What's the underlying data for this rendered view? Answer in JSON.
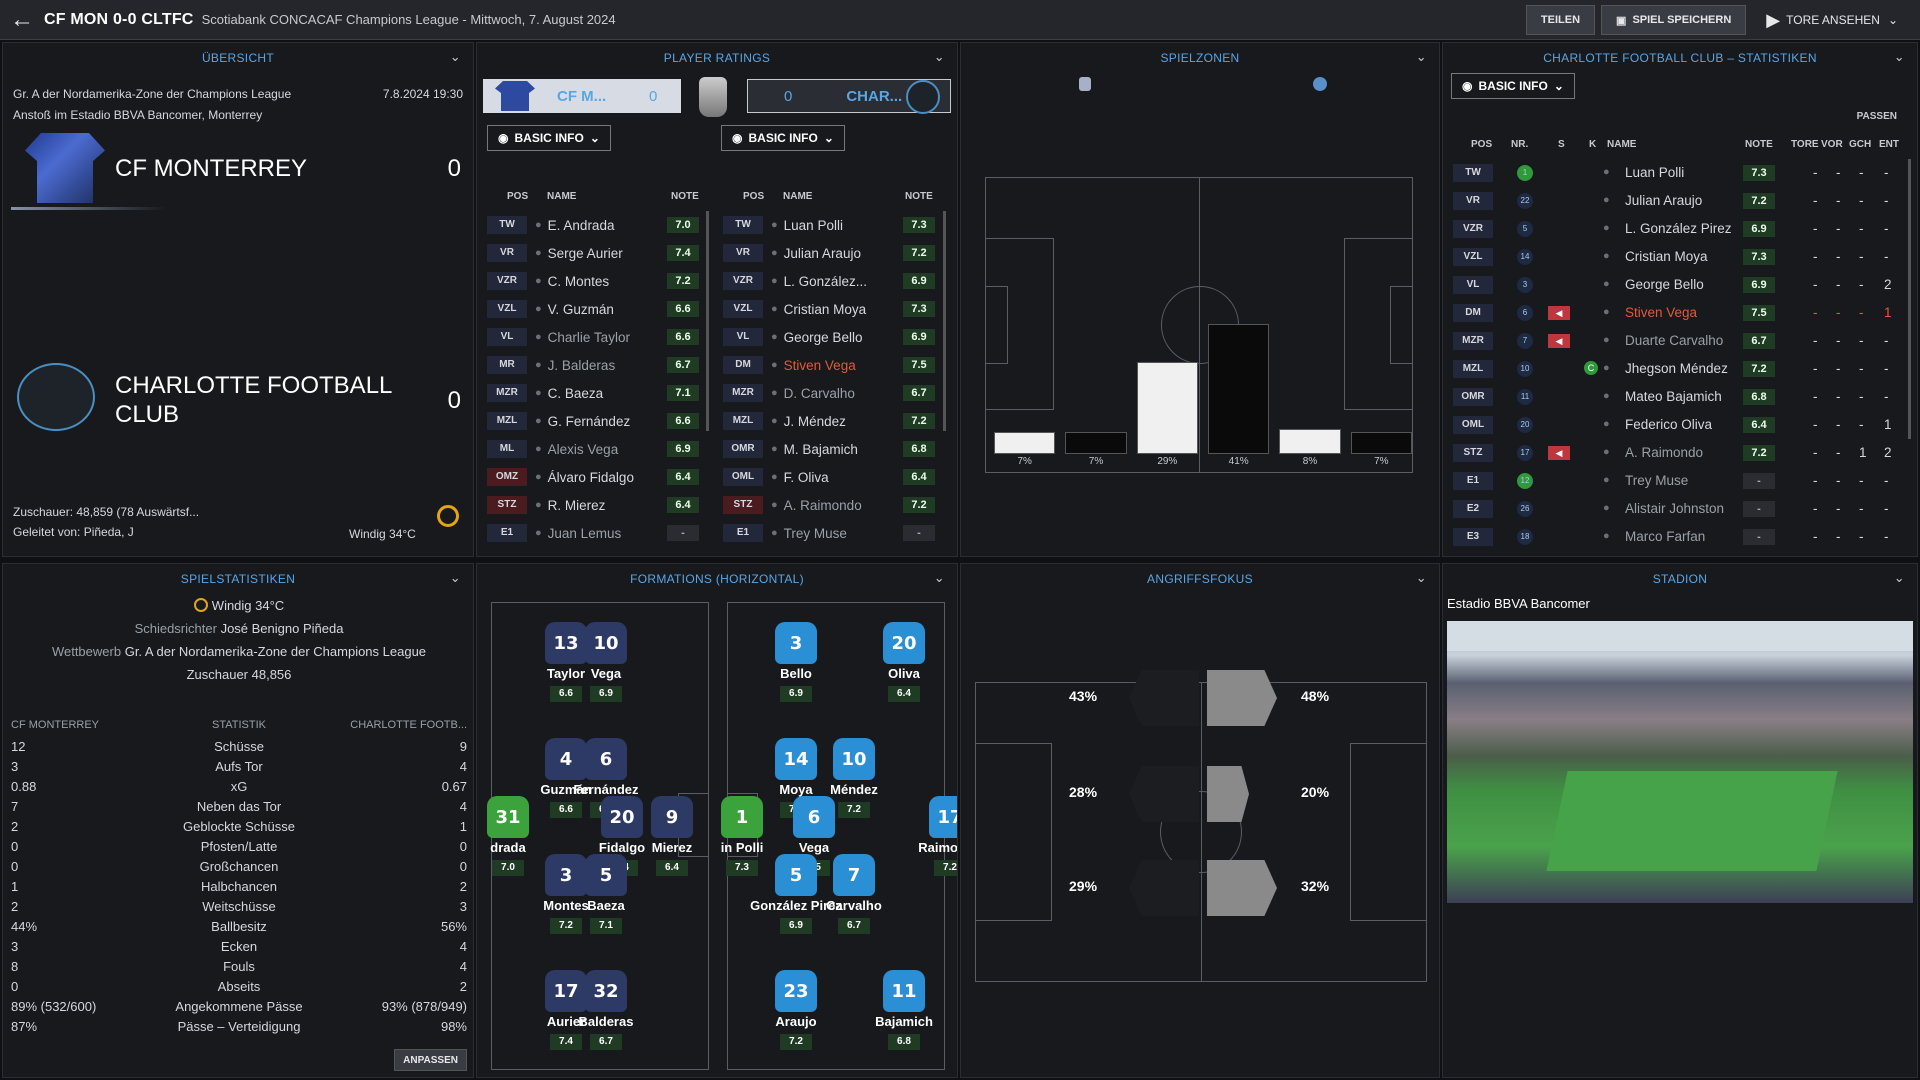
{
  "header": {
    "title_teams": "CF MON 0-0 CLTFC",
    "subtitle": "Scotiabank CONCACAF Champions League - Mittwoch, 7. August 2024",
    "buttons": [
      "TEILEN",
      "SPIEL SPEICHERN",
      "TORE ANSEHEN"
    ]
  },
  "overview": {
    "title": "ÜBERSICHT",
    "competition": "Gr. A der Nordamerika-Zone der Champions League",
    "datetime": "7.8.2024 19:30",
    "venue": "Anstoß im Estadio BBVA Bancomer, Monterrey",
    "home_name": "CF MONTERREY",
    "home_score": "0",
    "away_name": "CHARLOTTE FOOTBALL CLUB",
    "away_score": "0",
    "attendance": "Zuschauer: 48,859 (78 Auswärtsf...",
    "referee": "Geleitet von: Piñeda, J",
    "weather": "Windig 34°C"
  },
  "ratings": {
    "title": "PLAYER RATINGS",
    "home_short": "CF M...",
    "home_score": "0",
    "away_short": "CHAR...",
    "away_score": "0",
    "dropdown": "BASIC INFO",
    "col_pos": "POS",
    "col_name": "NAME",
    "col_note": "NOTE",
    "home": [
      {
        "pos": "TW",
        "name": "E. Andrada",
        "note": "7.0"
      },
      {
        "pos": "VR",
        "name": "Serge Aurier",
        "note": "7.4"
      },
      {
        "pos": "VZR",
        "name": "C. Montes",
        "note": "7.2"
      },
      {
        "pos": "VZL",
        "name": "V. Guzmán",
        "note": "6.6"
      },
      {
        "pos": "VL",
        "name": "Charlie Taylor",
        "note": "6.6"
      },
      {
        "pos": "MR",
        "name": "J. Balderas",
        "note": "6.7"
      },
      {
        "pos": "MZR",
        "name": "C. Baeza",
        "note": "7.1"
      },
      {
        "pos": "MZL",
        "name": "G. Fernández",
        "note": "6.6"
      },
      {
        "pos": "ML",
        "name": "Alexis Vega",
        "note": "6.9"
      },
      {
        "pos": "OMZ",
        "name": "Álvaro Fidalgo",
        "note": "6.4"
      },
      {
        "pos": "STZ",
        "name": "R. Mierez",
        "note": "6.4"
      },
      {
        "pos": "E1",
        "name": "Juan Lemus",
        "note": "-"
      }
    ],
    "away": [
      {
        "pos": "TW",
        "name": "Luan Polli",
        "note": "7.3"
      },
      {
        "pos": "VR",
        "name": "Julian Araujo",
        "note": "7.2"
      },
      {
        "pos": "VZR",
        "name": "L. González...",
        "note": "6.9"
      },
      {
        "pos": "VZL",
        "name": "Cristian Moya",
        "note": "7.3"
      },
      {
        "pos": "VL",
        "name": "George Bello",
        "note": "6.9"
      },
      {
        "pos": "DM",
        "name": "Stiven Vega",
        "note": "7.5"
      },
      {
        "pos": "MZR",
        "name": "D. Carvalho",
        "note": "6.7"
      },
      {
        "pos": "MZL",
        "name": "J. Méndez",
        "note": "7.2"
      },
      {
        "pos": "OMR",
        "name": "M. Bajamich",
        "note": "6.8"
      },
      {
        "pos": "OML",
        "name": "F. Oliva",
        "note": "6.4"
      },
      {
        "pos": "STZ",
        "name": "A. Raimondo",
        "note": "7.2"
      },
      {
        "pos": "E1",
        "name": "Trey Muse",
        "note": "-"
      }
    ]
  },
  "zones": {
    "title": "SPIELZONEN",
    "labels": [
      "7%",
      "7%",
      "29%",
      "41%",
      "8%",
      "7%"
    ],
    "values": [
      7,
      7,
      29,
      41,
      8,
      7
    ]
  },
  "stats_table": {
    "title": "CHARLOTTE FOOTBALL CLUB – STATISTIKEN",
    "dropdown": "BASIC INFO",
    "group": "PASSEN",
    "cols": [
      "POS",
      "NR.",
      "S",
      "K",
      "NAME",
      "NOTE",
      "TORE",
      "VOR",
      "GCH",
      "ENT"
    ],
    "rows": [
      {
        "pos": "TW",
        "nr": "1",
        "name": "Luan Polli",
        "note": "7.3",
        "tore": "-",
        "vor": "-",
        "gch": "-",
        "ent": "-"
      },
      {
        "pos": "VR",
        "nr": "22",
        "name": "Julian Araujo",
        "note": "7.2",
        "tore": "-",
        "vor": "-",
        "gch": "-",
        "ent": "-"
      },
      {
        "pos": "VZR",
        "nr": "5",
        "name": "L. González Pirez",
        "note": "6.9",
        "tore": "-",
        "vor": "-",
        "gch": "-",
        "ent": "-"
      },
      {
        "pos": "VZL",
        "nr": "14",
        "name": "Cristian Moya",
        "note": "7.3",
        "tore": "-",
        "vor": "-",
        "gch": "-",
        "ent": "-"
      },
      {
        "pos": "VL",
        "nr": "3",
        "name": "George Bello",
        "note": "6.9",
        "tore": "-",
        "vor": "-",
        "gch": "-",
        "ent": "2"
      },
      {
        "pos": "DM",
        "nr": "6",
        "name": "Stiven Vega",
        "note": "7.5",
        "tore": "-",
        "vor": "-",
        "gch": "-",
        "ent": "1"
      },
      {
        "pos": "MZR",
        "nr": "7",
        "name": "Duarte Carvalho",
        "note": "6.7",
        "tore": "-",
        "vor": "-",
        "gch": "-",
        "ent": "-"
      },
      {
        "pos": "MZL",
        "nr": "10",
        "name": "Jhegson Méndez",
        "note": "7.2",
        "tore": "-",
        "vor": "-",
        "gch": "-",
        "ent": "-"
      },
      {
        "pos": "OMR",
        "nr": "11",
        "name": "Mateo Bajamich",
        "note": "6.8",
        "tore": "-",
        "vor": "-",
        "gch": "-",
        "ent": "-"
      },
      {
        "pos": "OML",
        "nr": "20",
        "name": "Federico Oliva",
        "note": "6.4",
        "tore": "-",
        "vor": "-",
        "gch": "-",
        "ent": "1"
      },
      {
        "pos": "STZ",
        "nr": "17",
        "name": "A. Raimondo",
        "note": "7.2",
        "tore": "-",
        "vor": "-",
        "gch": "1",
        "ent": "2"
      },
      {
        "pos": "E1",
        "nr": "12",
        "name": "Trey Muse",
        "note": "-",
        "tore": "-",
        "vor": "-",
        "gch": "-",
        "ent": "-"
      },
      {
        "pos": "E2",
        "nr": "26",
        "name": "Alistair Johnston",
        "note": "-",
        "tore": "-",
        "vor": "-",
        "gch": "-",
        "ent": "-"
      },
      {
        "pos": "E3",
        "nr": "18",
        "name": "Marco Farfan",
        "note": "-",
        "tore": "-",
        "vor": "-",
        "gch": "-",
        "ent": "-"
      }
    ]
  },
  "match_stats": {
    "title": "SPIELSTATISTIKEN",
    "weather": "Windig 34°C",
    "ref_label": "Schiedsrichter",
    "ref_name": "José Benigno Piñeda",
    "comp_label": "Wettbewerb",
    "comp_name": "Gr. A der Nordamerika-Zone der Champions League",
    "attendance": "Zuschauer 48,856",
    "col_home": "CF MONTERREY",
    "col_stat": "STATISTIK",
    "col_away": "CHARLOTTE FOOTB...",
    "rows": [
      {
        "h": "12",
        "s": "Schüsse",
        "a": "9"
      },
      {
        "h": "3",
        "s": "Aufs Tor",
        "a": "4"
      },
      {
        "h": "0.88",
        "s": "xG",
        "a": "0.67"
      },
      {
        "h": "7",
        "s": "Neben das Tor",
        "a": "4"
      },
      {
        "h": "2",
        "s": "Geblockte Schüsse",
        "a": "1"
      },
      {
        "h": "0",
        "s": "Pfosten/Latte",
        "a": "0"
      },
      {
        "h": "0",
        "s": "Großchancen",
        "a": "0"
      },
      {
        "h": "1",
        "s": "Halbchancen",
        "a": "2"
      },
      {
        "h": "2",
        "s": "Weitschüsse",
        "a": "3"
      },
      {
        "h": "44%",
        "s": "Ballbesitz",
        "a": "56%"
      },
      {
        "h": "3",
        "s": "Ecken",
        "a": "4"
      },
      {
        "h": "8",
        "s": "Fouls",
        "a": "4"
      },
      {
        "h": "0",
        "s": "Abseits",
        "a": "2"
      },
      {
        "h": "89% (532/600)",
        "s": "Angekommene Pässe",
        "a": "93% (878/949)"
      },
      {
        "h": "87%",
        "s": "Pässe – Verteidigung",
        "a": "98%"
      }
    ],
    "button": "ANPASSEN"
  },
  "formations": {
    "title": "FORMATIONS (HORIZONTAL)",
    "home": [
      {
        "num": "13",
        "name": "Taylor",
        "rate": "6.6"
      },
      {
        "num": "10",
        "name": "Vega",
        "rate": "6.9"
      },
      {
        "num": "4",
        "name": "Guzmán",
        "rate": "6.6"
      },
      {
        "num": "6",
        "name": "Fernández",
        "rate": "6.6"
      },
      {
        "num": "31",
        "name": "drada",
        "rate": "7.0"
      },
      {
        "num": "20",
        "name": "Fidalgo",
        "rate": "6.4"
      },
      {
        "num": "9",
        "name": "Mierez",
        "rate": "6.4"
      },
      {
        "num": "3",
        "name": "Montes",
        "rate": "7.2"
      },
      {
        "num": "5",
        "name": "Baeza",
        "rate": "7.1"
      },
      {
        "num": "17",
        "name": "Aurier",
        "rate": "7.4"
      },
      {
        "num": "32",
        "name": "Balderas",
        "rate": "6.7"
      }
    ],
    "away": [
      {
        "num": "3",
        "name": "Bello",
        "rate": "6.9"
      },
      {
        "num": "20",
        "name": "Oliva",
        "rate": "6.4"
      },
      {
        "num": "14",
        "name": "Moya",
        "rate": "7.3"
      },
      {
        "num": "10",
        "name": "Méndez",
        "rate": "7.2"
      },
      {
        "num": "1",
        "name": "in Polli",
        "rate": "7.3"
      },
      {
        "num": "6",
        "name": "Vega",
        "rate": "7.5"
      },
      {
        "num": "17",
        "name": "Raimondo",
        "rate": "7.2"
      },
      {
        "num": "5",
        "name": "González Pirez",
        "rate": "6.9"
      },
      {
        "num": "7",
        "name": "Carvalho",
        "rate": "6.7"
      },
      {
        "num": "23",
        "name": "Araujo",
        "rate": "7.2"
      },
      {
        "num": "11",
        "name": "Bajamich",
        "rate": "6.8"
      }
    ]
  },
  "attack": {
    "title": "ANGRIFFSFOKUS",
    "home": [
      "43%",
      "28%",
      "29%"
    ],
    "away": [
      "48%",
      "20%",
      "32%"
    ]
  },
  "stadium": {
    "title": "STADION",
    "name": "Estadio BBVA Bancomer"
  },
  "colors": {
    "accent": "#58a6e6",
    "home_kit": "#2d3a66",
    "away_kit": "#2b8fd6",
    "keeper": "#3ca33c"
  }
}
